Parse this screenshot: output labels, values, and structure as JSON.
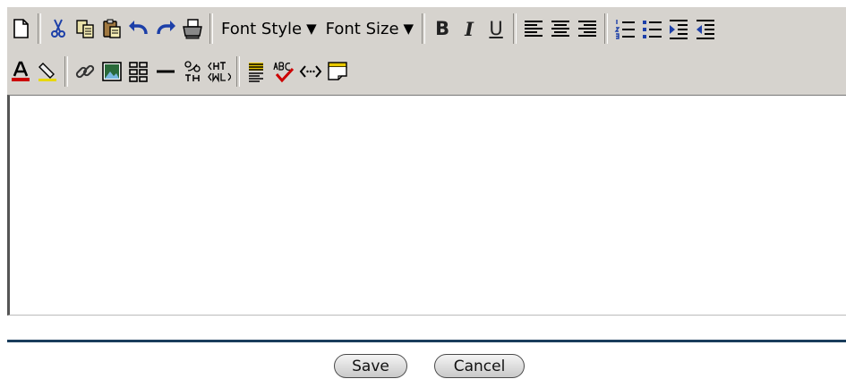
{
  "toolbar": {
    "font_style_label": "Font Style",
    "font_size_label": "Font Size",
    "dropdown_arrow": "▼",
    "bold_label": "B",
    "italic_label": "I",
    "underline_label": "U"
  },
  "icons": [
    "new-document-icon",
    "cut-icon",
    "copy-icon",
    "paste-icon",
    "undo-icon",
    "redo-icon",
    "print-icon",
    "align-left-icon",
    "align-center-icon",
    "align-right-icon",
    "ordered-list-icon",
    "unordered-list-icon",
    "indent-icon",
    "outdent-icon",
    "text-color-icon",
    "highlight-icon",
    "link-icon",
    "image-icon",
    "table-icon",
    "horizontal-rule-icon",
    "special-character-icon",
    "html-icon",
    "style-icon",
    "spellcheck-icon",
    "source-code-icon",
    "template-icon"
  ],
  "buttons": {
    "save": "Save",
    "cancel": "Cancel"
  },
  "colors": {
    "toolbar_bg": "#d6d3ce",
    "icon_blue": "#1c3fa8",
    "rule": "#1a3d5c"
  }
}
